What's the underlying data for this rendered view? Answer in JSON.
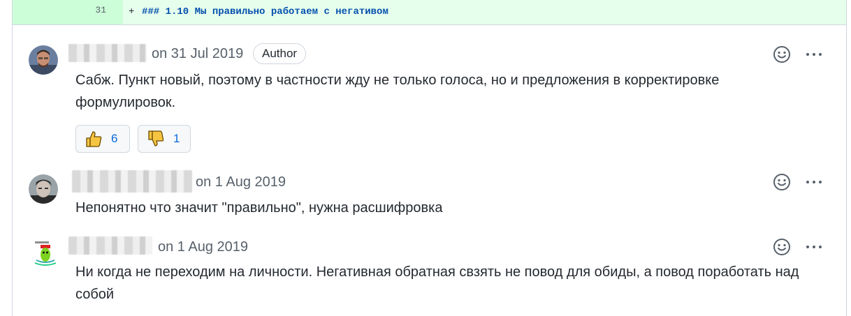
{
  "diff": {
    "line_number": "31",
    "marker": "+",
    "code": "### 1.10 Мы правильно работаем с негативом"
  },
  "comments": [
    {
      "date": "on 31 Jul 2019",
      "badge": "Author",
      "body": "Сабж. Пункт новый, поэтому в частности жду не только голоса, но и предложения в корректировке формулировок.",
      "reactions": [
        {
          "icon": "thumbs-up-icon",
          "count": "6"
        },
        {
          "icon": "thumbs-down-icon",
          "count": "1"
        }
      ]
    },
    {
      "date": "on 1 Aug 2019",
      "body": "Непонятно что значит \"правильно\", нужна расшифровка"
    },
    {
      "date": "on 1 Aug 2019",
      "body": "Ни когда не переходим на личности. Негативная обратная свзять не повод для обиды, а повод поработать над собой"
    }
  ],
  "colors": {
    "added_line_bg": "#e6ffec",
    "added_gutter_bg": "#ccffd8",
    "link_blue": "#0969da",
    "muted_text": "#57606a",
    "border": "#d0d7de"
  }
}
